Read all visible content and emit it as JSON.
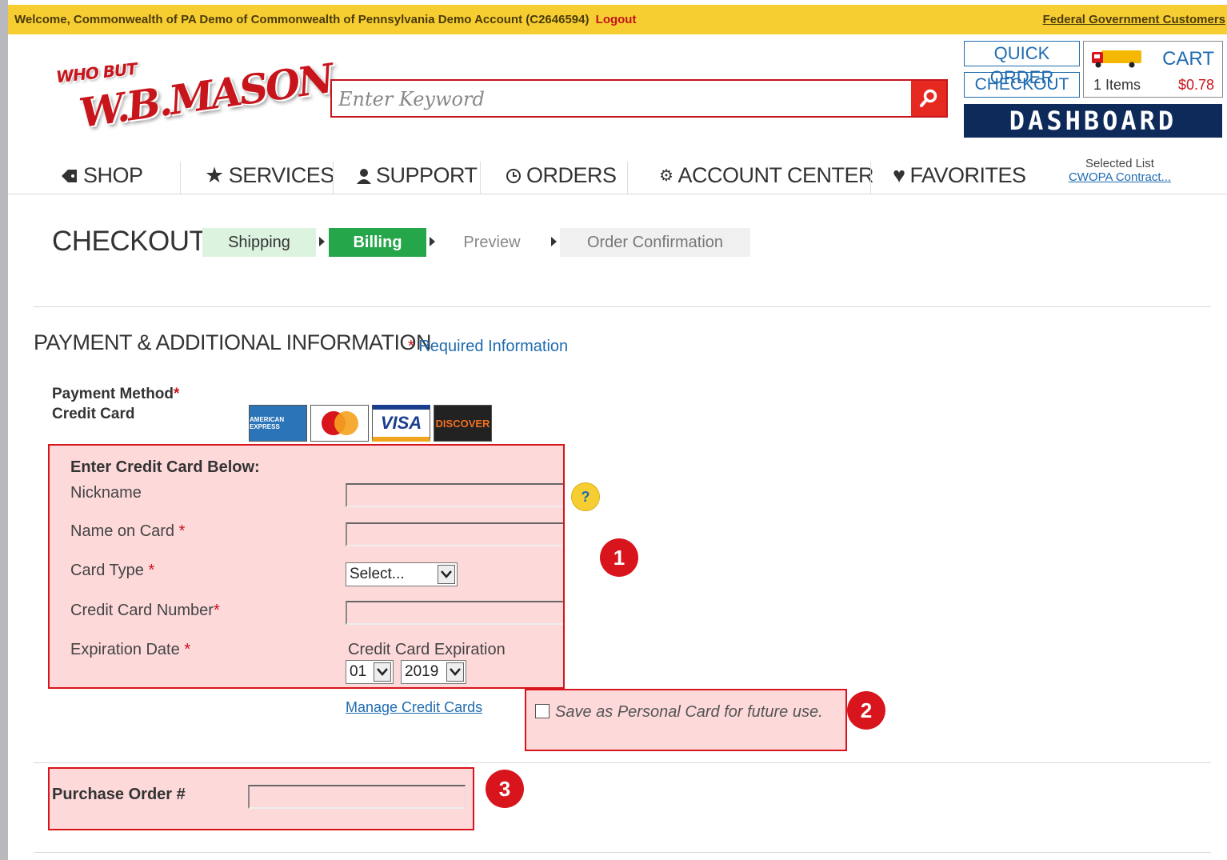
{
  "topbar": {
    "welcome": "Welcome, Commonwealth of PA Demo of Commonwealth of Pennsylvania Demo Account (C2646594)",
    "logout": "Logout",
    "federal": "Federal Government Customers"
  },
  "logo": {
    "tagline": "WHO BUT",
    "brand": "W.B.MASON"
  },
  "search": {
    "placeholder": "Enter Keyword"
  },
  "header": {
    "quick_order": "QUICK ORDER",
    "checkout": "CHECKOUT",
    "cart_label": "CART",
    "cart_items": "1 Items",
    "cart_total": "$0.78",
    "dashboard": "DASHBOARD"
  },
  "nav": {
    "items": [
      "SHOP",
      "SERVICES",
      "SUPPORT",
      "ORDERS",
      "ACCOUNT CENTER",
      "FAVORITES"
    ],
    "selected_list_label": "Selected List",
    "selected_list_value": "CWOPA Contract..."
  },
  "checkout": {
    "title": "CHECKOUT",
    "steps": [
      "Shipping",
      "Billing",
      "Preview",
      "Order Confirmation"
    ],
    "active_step": "Billing"
  },
  "payment": {
    "section_title": "PAYMENT & ADDITIONAL INFORMATION",
    "required_info": "Required Information",
    "method_label": "Payment Method",
    "method_value": "Credit Card",
    "cards": [
      "American Express",
      "MasterCard",
      "VISA",
      "DISCOVER"
    ],
    "enter_below": "Enter Credit Card Below:",
    "nickname": "Nickname",
    "name_on_card": "Name on Card",
    "card_type": "Card Type",
    "card_type_value": "Select...",
    "card_number": "Credit Card Number",
    "expiration": "Expiration Date",
    "expiration_sub": "Credit Card Expiration",
    "exp_month": "01",
    "exp_year": "2019",
    "manage_cards": "Manage Credit Cards",
    "save_card": "Save as Personal Card for future use.",
    "purchase_order": "Purchase Order #"
  },
  "annotations": [
    "1",
    "2",
    "3"
  ],
  "colors": {
    "brand_red": "#c8141b",
    "yellow": "#f7ce32",
    "link_blue": "#1f6bb0",
    "step_green": "#26a64a",
    "highlight": "#fdd9da"
  }
}
